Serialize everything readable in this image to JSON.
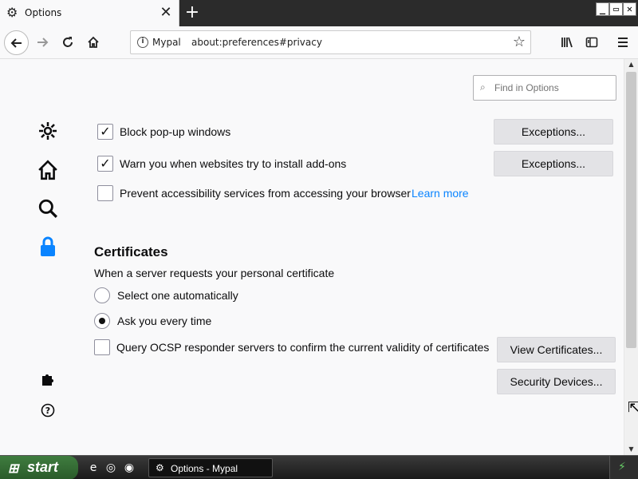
{
  "tab": {
    "title": "Options",
    "close": "✕",
    "new_tab": "+"
  },
  "window_controls": {
    "minimize": "_",
    "restore": "▭",
    "close": "✕"
  },
  "urlbar": {
    "site_name": "Mypal",
    "url": "about:preferences#privacy"
  },
  "search": {
    "placeholder": "Find in Options"
  },
  "permissions": [
    {
      "label": "Block pop-up windows",
      "checked": true,
      "button": "Exceptions..."
    },
    {
      "label": "Warn you when websites try to install add-ons",
      "checked": true,
      "button": "Exceptions..."
    },
    {
      "label": "Prevent accessibility services from accessing your browser",
      "checked": false,
      "link": "Learn more"
    }
  ],
  "certificates": {
    "heading": "Certificates",
    "prompt": "When a server requests your personal certificate",
    "options": [
      {
        "label": "Select one automatically",
        "selected": false
      },
      {
        "label": "Ask you every time",
        "selected": true
      }
    ],
    "ocsp": {
      "label": "Query OCSP responder servers to confirm the current validity of certificates",
      "checked": false
    },
    "view_button": "View Certificates...",
    "devices_button": "Security Devices..."
  },
  "taskbar": {
    "start": "start",
    "task": "Options - Mypal"
  },
  "colors": {
    "link": "#0a84ff",
    "active_category": "#0a84ff"
  }
}
